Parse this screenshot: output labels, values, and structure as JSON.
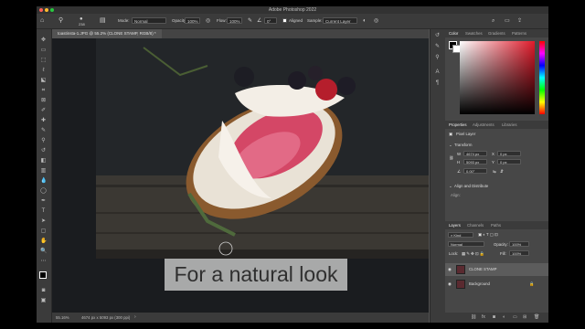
{
  "title": "Adobe Photoshop 2022",
  "options_bar": {
    "brush_size": "238",
    "mode_label": "Mode:",
    "mode_value": "Normal",
    "opacity_label": "Opacity:",
    "opacity_value": "100%",
    "flow_label": "Flow:",
    "flow_value": "100%",
    "angle_value": "0°",
    "aligned_label": "Aligned",
    "sample_label": "Sample:",
    "sample_value": "Current Layer"
  },
  "document": {
    "tab_label": "toastinsta-1.JPG @ 55.2% (CLONE STAMP, RGB/8) *",
    "zoom": "55.16%",
    "doc_size": "4674 px x 5093 px (300 ppi)"
  },
  "caption": "For a natural look",
  "panels": {
    "color_tabs": [
      "Color",
      "Swatches",
      "Gradients",
      "Patterns"
    ],
    "properties_tabs": [
      "Properties",
      "Adjustments",
      "Libraries"
    ],
    "pixel_layer_label": "Pixel Layer",
    "transform_label": "Transform",
    "w_label": "W",
    "w_value": "4674 px",
    "h_label": "H",
    "h_value": "5093 px",
    "x_label": "X",
    "x_value": "0 px",
    "y_label": "Y",
    "y_value": "0 px",
    "angle_value": "0.00°",
    "align_label": "Align and Distribute",
    "align_sub": "Align:",
    "layers_tabs": [
      "Layers",
      "Channels",
      "Paths"
    ],
    "kind_label": "Kind",
    "blend_mode": "Normal",
    "opacity_label": "Opacity:",
    "opacity_value": "100%",
    "lock_label": "Lock:",
    "fill_label": "Fill:",
    "fill_value": "100%",
    "layers": [
      "CLONE STAMP",
      "Background"
    ]
  },
  "colors": {
    "hue_color": "#e01a2a",
    "active_layer_bg": "#5c5c5c"
  }
}
